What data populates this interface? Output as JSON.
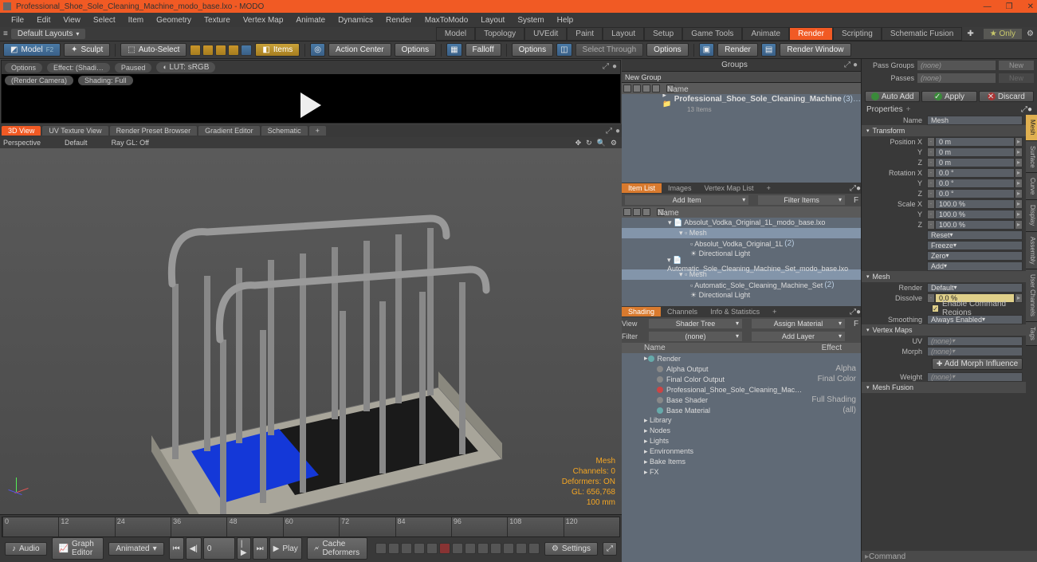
{
  "window": {
    "title": "Professional_Shoe_Sole_Cleaning_Machine_modo_base.lxo - MODO"
  },
  "menu": [
    "File",
    "Edit",
    "View",
    "Select",
    "Item",
    "Geometry",
    "Texture",
    "Vertex Map",
    "Animate",
    "Dynamics",
    "Render",
    "MaxToModo",
    "Layout",
    "System",
    "Help"
  ],
  "layouts": {
    "dropdown": "Default Layouts",
    "tabs": [
      "Model",
      "Topology",
      "UVEdit",
      "Paint",
      "Layout",
      "Setup",
      "Game Tools",
      "Animate",
      "Render",
      "Scripting",
      "Schematic Fusion"
    ],
    "active": "Render",
    "only": "Only"
  },
  "toolrow": {
    "model": "Model",
    "sculpt": "Sculpt",
    "autoselect": "Auto-Select",
    "items": "Items",
    "actioncenter": "Action Center",
    "options": "Options",
    "falloff": "Falloff",
    "options2": "Options",
    "selectthrough": "Select Through",
    "options3": "Options",
    "render": "Render",
    "renderwindow": "Render Window"
  },
  "preview": {
    "options": "Options",
    "effect": "Effect: (Shadi…",
    "paused": "Paused",
    "lut": "LUT: sRGB",
    "rendercam": "(Render Camera)",
    "shading": "Shading: Full"
  },
  "viewTabs": [
    "3D View",
    "UV Texture View",
    "Render Preset Browser",
    "Gradient Editor",
    "Schematic",
    "+"
  ],
  "viewOpts": {
    "persp": "Perspective",
    "default": "Default",
    "raygl": "Ray GL: Off"
  },
  "hud": {
    "type": "Mesh",
    "channels": "Channels: 0",
    "deformers": "Deformers: ON",
    "gl": "GL: 656,768",
    "scale": "100 mm"
  },
  "timeline": {
    "ticks": [
      "0",
      "12",
      "24",
      "36",
      "48",
      "60",
      "72",
      "84",
      "96",
      "108",
      "120"
    ],
    "audio": "Audio",
    "grapheditor": "Graph Editor",
    "animated": "Animated",
    "frame": "0",
    "play": "Play",
    "cache": "Cache Deformers",
    "settings": "Settings"
  },
  "groups": {
    "title": "Groups",
    "newgroup": "New Group",
    "nameCol": "Name",
    "item": "Professional_Shoe_Sole_Cleaning_Machine",
    "itemAfter": "(3)…",
    "sub": "13 Items"
  },
  "itemlist": {
    "tabs": [
      "Item List",
      "Images",
      "Vertex Map List",
      "+"
    ],
    "addItem": "Add Item",
    "filter": "Filter Items",
    "nameCol": "Name",
    "rows": [
      {
        "t": "Absolut_Vodka_Original_1L_modo_base.lxo",
        "d": 1,
        "type": "scene"
      },
      {
        "t": "Mesh",
        "d": 2,
        "type": "mesh",
        "sel": true
      },
      {
        "t": "Absolut_Vodka_Original_1L",
        "a": "(2)",
        "d": 3,
        "type": "loc"
      },
      {
        "t": "Directional Light",
        "d": 3,
        "type": "light"
      },
      {
        "t": "Automatic_Sole_Cleaning_Machine_Set_modo_base.lxo",
        "d": 1,
        "type": "scene"
      },
      {
        "t": "Mesh",
        "d": 2,
        "type": "mesh",
        "sel": true
      },
      {
        "t": "Automatic_Sole_Cleaning_Machine_Set",
        "a": "(2)",
        "d": 3,
        "type": "loc"
      },
      {
        "t": "Directional Light",
        "d": 3,
        "type": "light"
      }
    ]
  },
  "shading": {
    "tabs": [
      "Shading",
      "Channels",
      "Info & Statistics",
      "+"
    ],
    "view": "View",
    "shadertree": "Shader Tree",
    "assign": "Assign Material",
    "filter": "Filter",
    "none": "(none)",
    "addlayer": "Add Layer",
    "nameCol": "Name",
    "effectCol": "Effect",
    "rows": [
      {
        "t": "Render",
        "d": 1,
        "dot": "teal"
      },
      {
        "t": "Alpha Output",
        "d": 2,
        "e": "Alpha",
        "dot": "gray"
      },
      {
        "t": "Final Color Output",
        "d": 2,
        "e": "Final Color",
        "dot": "gray"
      },
      {
        "t": "Professional_Shoe_Sole_Cleaning_Mac…",
        "d": 2,
        "dot": "red"
      },
      {
        "t": "Base Shader",
        "d": 2,
        "e": "Full Shading",
        "dot": "gray"
      },
      {
        "t": "Base Material",
        "d": 2,
        "e": "(all)",
        "dot": "teal"
      },
      {
        "t": "Library",
        "d": 1
      },
      {
        "t": "Nodes",
        "d": 1
      },
      {
        "t": "Lights",
        "d": 1
      },
      {
        "t": "Environments",
        "d": 1
      },
      {
        "t": "Bake Items",
        "d": 1
      },
      {
        "t": "FX",
        "d": 1
      }
    ]
  },
  "right": {
    "passgroups": "Pass Groups",
    "passes": "Passes",
    "none": "(none)",
    "new": "New",
    "autoadd": "Auto Add",
    "apply": "Apply",
    "discard": "Discard",
    "properties": "Properties",
    "nameLbl": "Name",
    "nameVal": "Mesh",
    "transform": "Transform",
    "posx": "Position X",
    "y": "Y",
    "z": "Z",
    "zero": "0 m",
    "rotx": "Rotation X",
    "rotzero": "0.0 °",
    "scalex": "Scale X",
    "hundred": "100.0 %",
    "reset": "Reset",
    "freeze": "Freeze",
    "zeroBtn": "Zero",
    "add": "Add",
    "meshH": "Mesh",
    "renderLbl": "Render",
    "default": "Default",
    "dissolve": "Dissolve",
    "dissolveVal": "0.0 %",
    "enablecmd": "Enable Command Regions",
    "smoothing": "Smoothing",
    "always": "Always Enabled",
    "vertmaps": "Vertex Maps",
    "uv": "UV",
    "morph": "Morph",
    "weight": "Weight",
    "addmorph": "Add Morph Influence",
    "meshfusion": "Mesh Fusion",
    "sideTabs": [
      "Mesh",
      "Surface",
      "Curve",
      "Display",
      "Assembly",
      "User Channels",
      "Tags"
    ],
    "command": "Command"
  }
}
